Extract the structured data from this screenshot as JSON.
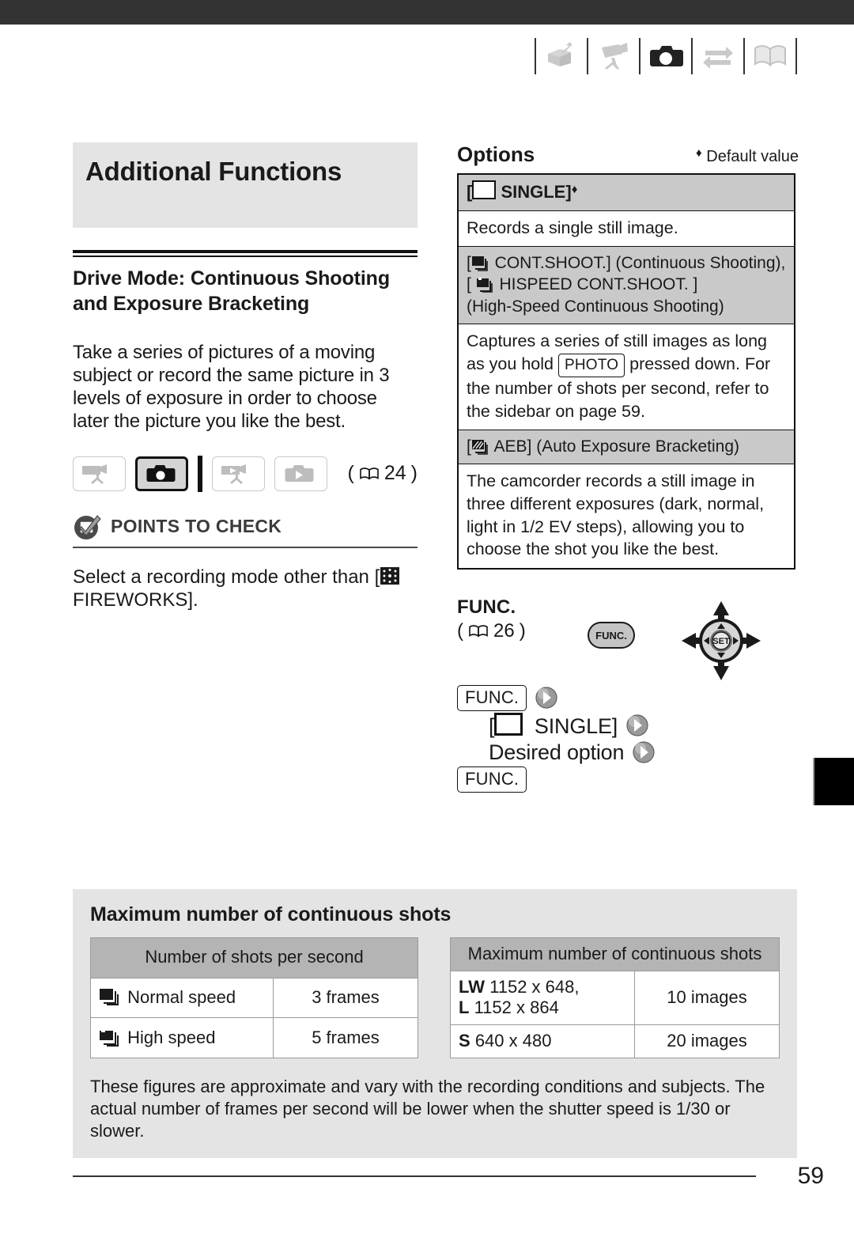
{
  "header": {
    "icons": [
      {
        "name": "unpack-box-icon",
        "state": "inactive"
      },
      {
        "name": "camcorder-record-icon",
        "state": "inactive"
      },
      {
        "name": "photo-camera-icon",
        "state": "active"
      },
      {
        "name": "exchange-arrows-icon",
        "state": "inactive"
      },
      {
        "name": "open-book-icon",
        "state": "inactive"
      }
    ]
  },
  "left": {
    "chapter_title": "Additional Functions",
    "section_title": "Drive Mode: Continuous Shooting and Exposure Bracketing",
    "intro": "Take a series of pictures of a moving subject or record the same picture in 3 levels of exposure in order to choose later the picture you like the best.",
    "mode_buttons": [
      {
        "name": "camcorder-record-mode",
        "active": false
      },
      {
        "name": "photo-camera-mode",
        "active": true
      },
      {
        "name": "camcorder-play-mode",
        "active": false
      },
      {
        "name": "photo-play-mode",
        "active": false
      }
    ],
    "mode_page_ref": "24",
    "points_to_check": {
      "label": "POINTS TO CHECK",
      "icon": "checkmark-circle-icon",
      "text_before": "Select a recording mode other than [",
      "bracket_icon": "fireworks-icon",
      "text_after": "FIREWORKS]."
    }
  },
  "right": {
    "options_title": "Options",
    "default_value_note": "Default value",
    "default_marker": "♦",
    "options": [
      {
        "header": "[□ SINGLE]♦",
        "header_label": "SINGLE",
        "header_bold": true,
        "header_icon": "single-frame-icon",
        "body": "Records a single still image."
      },
      {
        "header_lines": [
          "[🗐 CONT.SHOOT.] (Continuous Shooting),",
          "[ 🗐 HISPEED CONT.SHOOT. ]",
          "(High-Speed Continuous Shooting)"
        ],
        "header_icon": "continuous-shooting-icon",
        "body_part1": "Captures a series of still images as long as you hold",
        "body_button": "PHOTO",
        "body_part2": "pressed down. For the number of shots per second, refer to the sidebar on page 59."
      },
      {
        "header": "[▨ AEB] (Auto Exposure Bracketing)",
        "header_icon": "aeb-icon",
        "body": "The camcorder records a still image in three different exposures (dark, normal, light in 1/2 EV steps), allowing you to choose the shot you like the best."
      }
    ],
    "func": {
      "label": "FUNC.",
      "page_ref": "26",
      "button_label": "FUNC.",
      "joystick_center_label": "SET",
      "steps": [
        {
          "type": "box",
          "label": "FUNC.",
          "arrow": true
        },
        {
          "type": "text",
          "label": "[□ SINGLE]",
          "indent": true,
          "arrow": true
        },
        {
          "type": "text",
          "label": "Desired option",
          "indent": true,
          "arrow": true
        },
        {
          "type": "box",
          "label": "FUNC.",
          "arrow": false
        }
      ]
    }
  },
  "sidebar": {
    "title": "Maximum number of continuous shots",
    "table_left": {
      "header": "Number of shots per second",
      "rows": [
        {
          "icon": "normal-speed-burst-icon",
          "label": "Normal speed",
          "value": "3 frames"
        },
        {
          "icon": "high-speed-burst-icon",
          "label": "High speed",
          "value": "5 frames"
        }
      ]
    },
    "table_right": {
      "header": "Maximum number of continuous shots",
      "rows": [
        {
          "size_badge_1": "LW",
          "size_text_1": "1152 x 648,",
          "size_badge_2": "L",
          "size_text_2": "1152 x 864",
          "value": "10 images"
        },
        {
          "size_badge_1": "S",
          "size_text_1": "640 x 480",
          "size_badge_2": "",
          "size_text_2": "",
          "value": "20 images"
        }
      ]
    },
    "note": "These figures are approximate and vary with the recording conditions and subjects. The actual number of frames per second will be lower when the shutter speed is 1/30 or slower."
  },
  "footer": {
    "page_number": "59"
  },
  "colors": {
    "topbar": "#333333",
    "chapter_box": "#e4e4e4",
    "table_header_grey": "#c9c9c9",
    "sidebar_bg": "#e4e4e4",
    "sidebar_header_grey": "#b4b4b4",
    "accent_black": "#000000"
  }
}
